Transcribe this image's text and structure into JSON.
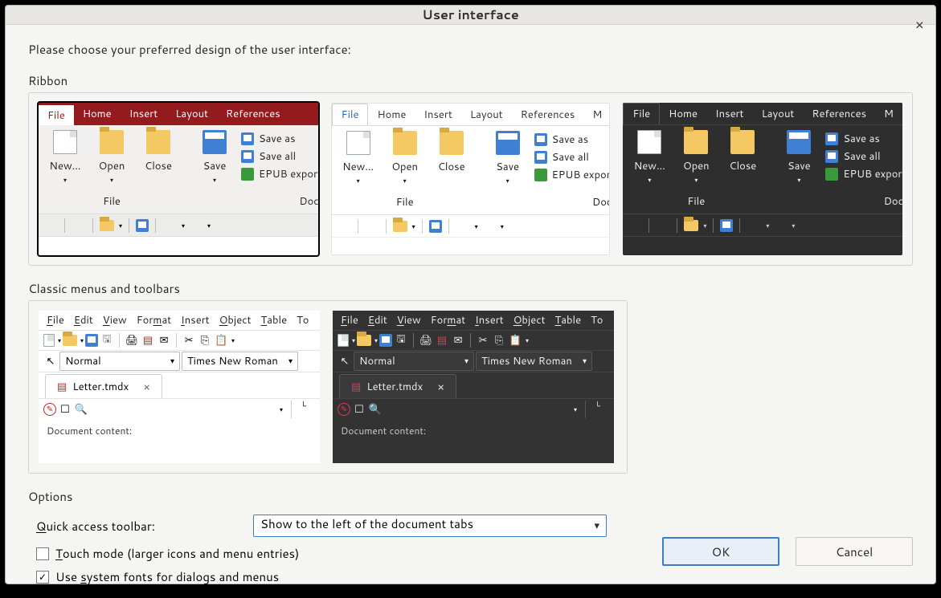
{
  "window": {
    "title": "User interface"
  },
  "intro": "Please choose your preferred design of the user interface:",
  "sections": {
    "ribbon": "Ribbon",
    "classic": "Classic menus and toolbars",
    "options": "Options"
  },
  "ribbon_tabs": [
    "File",
    "Home",
    "Insert",
    "Layout",
    "References",
    "M"
  ],
  "ribbon_buttons": {
    "new": "New…",
    "open": "Open",
    "close": "Close",
    "save": "Save"
  },
  "ribbon_minis": [
    "Save as",
    "Save all",
    "EPUB export"
  ],
  "ribbon_group_labels": {
    "file": "File",
    "doc": "Docu"
  },
  "classic_menus": [
    "File",
    "Edit",
    "View",
    "Format",
    "Insert",
    "Object",
    "Table",
    "To"
  ],
  "classic_style_combo": "Normal",
  "classic_font_combo": "Times New Roman",
  "classic_tab": "Letter.tmdx",
  "classic_side_label": "Document content:",
  "options": {
    "qat_label": "Quick access toolbar:",
    "qat_value": "Show to the left of the document tabs",
    "touch": "Touch mode (larger icons and menu entries)",
    "sysfont": "Use system fonts for dialogs and menus",
    "touch_checked": false,
    "sysfont_checked": true
  },
  "buttons": {
    "ok": "OK",
    "cancel": "Cancel"
  }
}
